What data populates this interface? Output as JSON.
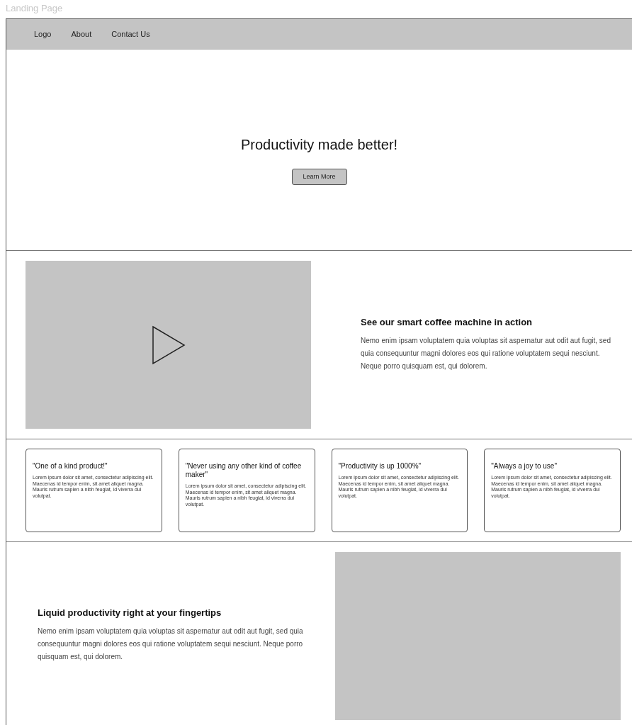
{
  "page_title": "Landing Page",
  "nav": {
    "items": [
      "Logo",
      "About",
      "Contact Us"
    ]
  },
  "hero": {
    "heading": "Productivity made better!",
    "button": "Learn More"
  },
  "feature": {
    "media": {
      "kind": "video"
    },
    "heading": "See our smart coffee machine in action",
    "body": "Nemo enim ipsam voluptatem quia voluptas sit aspernatur aut odit aut fugit, sed quia consequuntur magni dolores eos qui ratione voluptatem sequi nesciunt. Neque porro quisquam est, qui dolorem."
  },
  "testimonials": [
    {
      "quote": "\"One of a kind product!\"",
      "body": "Lorem ipsum dolor sit amet, consectetur adipiscing elit. Maecenas id tempor enim, sit amet aliquet magna. Mauris rutrum sapien a nibh feugiat, id viverra dui volutpat."
    },
    {
      "quote": "\"Never using any other kind of coffee maker\"",
      "body": "Lorem ipsum dolor sit amet, consectetur adipiscing elit. Maecenas id tempor enim, sit amet aliquet magna. Mauris rutrum sapien a nibh feugiat, id viverra dui volutpat."
    },
    {
      "quote": "\"Productivity is up 1000%\"",
      "body": "Lorem ipsum dolor sit amet, consectetur adipiscing elit. Maecenas id tempor enim, sit amet aliquet magna. Mauris rutrum sapien a nibh feugiat, id viverra dui volutpat."
    },
    {
      "quote": "\"Always a joy to use\"",
      "body": "Lorem ipsum dolor sit amet, consectetur adipiscing elit. Maecenas id tempor enim, sit amet aliquet magna. Mauris rutrum sapien a nibh feugiat, id viverra dui volutpat."
    }
  ],
  "closing": {
    "heading": "Liquid productivity right at your fingertips",
    "body": "Nemo enim ipsam voluptatem quia voluptas sit aspernatur aut odit aut fugit, sed quia consequuntur magni dolores eos qui ratione voluptatem sequi nesciunt. Neque porro quisquam est, qui dolorem.",
    "media": {
      "kind": "image"
    }
  }
}
